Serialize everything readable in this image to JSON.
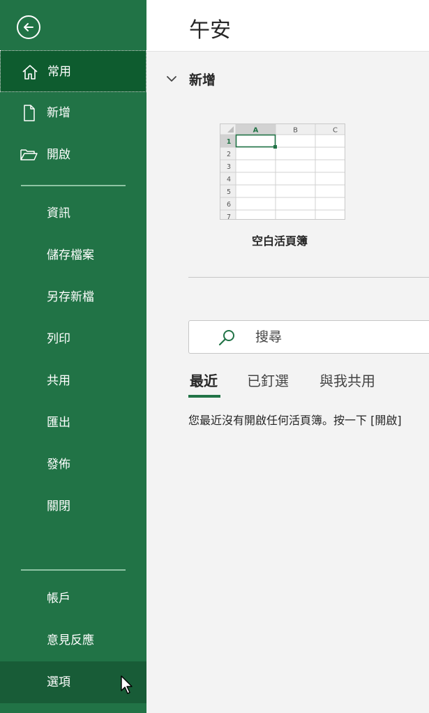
{
  "sidebar": {
    "items": [
      {
        "label": "常用"
      },
      {
        "label": "新增"
      },
      {
        "label": "開啟"
      },
      {
        "label": "資訊"
      },
      {
        "label": "儲存檔案"
      },
      {
        "label": "另存新檔"
      },
      {
        "label": "列印"
      },
      {
        "label": "共用"
      },
      {
        "label": "匯出"
      },
      {
        "label": "發佈"
      },
      {
        "label": "關閉"
      },
      {
        "label": "帳戶"
      },
      {
        "label": "意見反應"
      },
      {
        "label": "選項"
      }
    ]
  },
  "header": {
    "greeting": "午安"
  },
  "new_section": {
    "title": "新增",
    "template": {
      "label": "空白活頁簿",
      "columns": [
        "A",
        "B",
        "C"
      ],
      "rows": [
        "1",
        "2",
        "3",
        "4",
        "5",
        "6",
        "7"
      ]
    }
  },
  "search": {
    "placeholder": "搜尋"
  },
  "tabs": [
    {
      "label": "最近"
    },
    {
      "label": "已釘選"
    },
    {
      "label": "與我共用"
    }
  ],
  "recent": {
    "empty_message": "您最近沒有開啟任何活頁簿。按一下 [開啟]"
  },
  "colors": {
    "accent": "#217346",
    "sidebar_active": "#0e5c2f"
  }
}
